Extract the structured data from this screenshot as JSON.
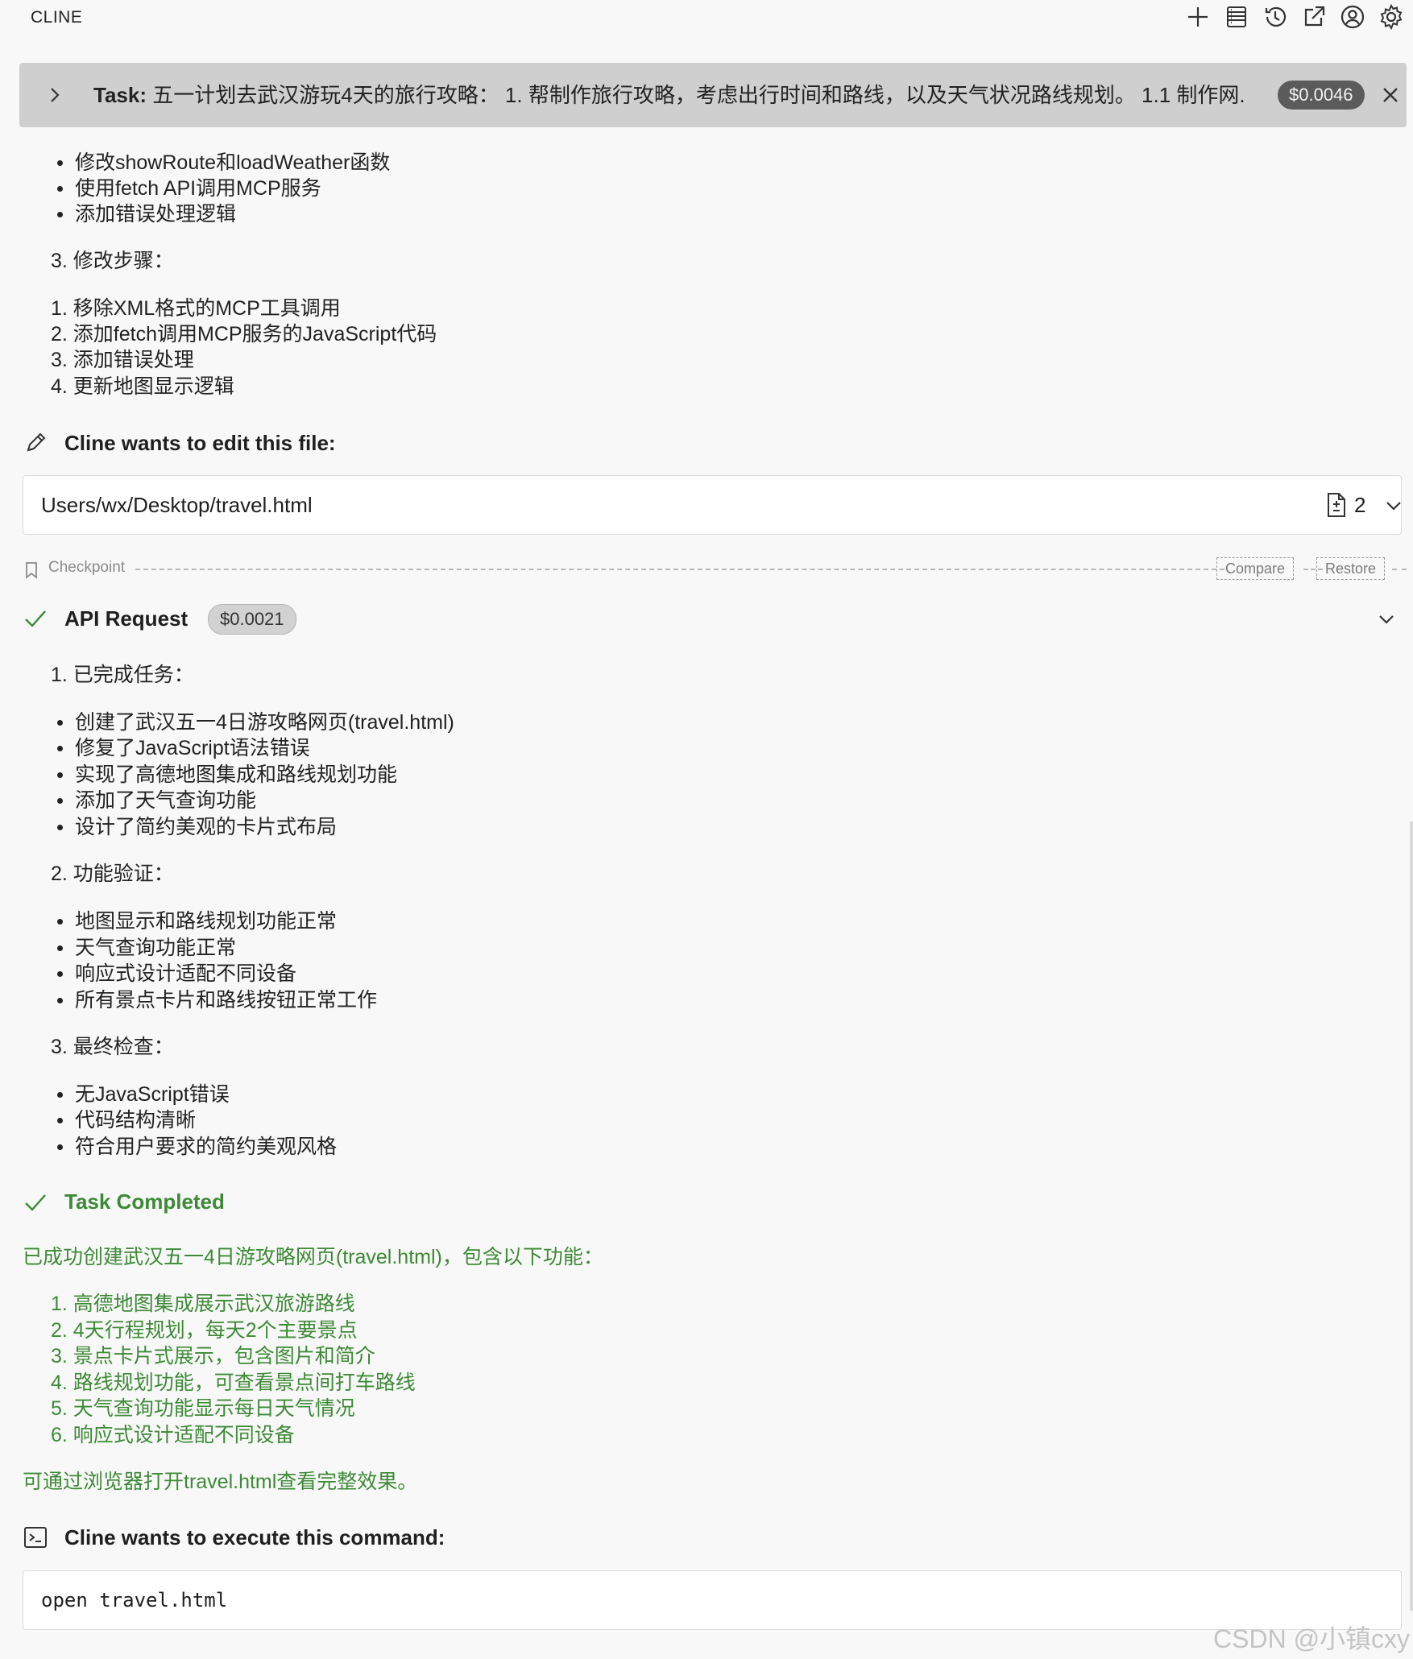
{
  "app": {
    "title": "CLINE"
  },
  "toolbar": {
    "icons": [
      "plus-icon",
      "history-list-icon",
      "clock-history-icon",
      "popout-icon",
      "account-icon",
      "gear-icon"
    ]
  },
  "task": {
    "label": "Task:",
    "text": "五一计划去武汉游玩4天的旅行攻略： 1. 帮制作旅行攻略，考虑出行时间和路线，以及天气状况路线规划。 1.1 制作网...",
    "cost": "$0.0046"
  },
  "intro": {
    "bullets": [
      "修改showRoute和loadWeather函数",
      "使用fetch API调用MCP服务",
      "添加错误处理逻辑"
    ],
    "step3_title": "3. 修改步骤：",
    "steps": [
      "1. 移除XML格式的MCP工具调用",
      "2. 添加fetch调用MCP服务的JavaScript代码",
      "3. 添加错误处理",
      "4. 更新地图显示逻辑"
    ]
  },
  "edit": {
    "heading": "Cline wants to edit this file:",
    "path": "Users/wx/Desktop/travel.html",
    "count": "2"
  },
  "checkpoint": {
    "label": "Checkpoint",
    "compare": "Compare",
    "restore": "Restore"
  },
  "api": {
    "heading": "API Request",
    "cost": "$0.0021",
    "s1_title": "1. 已完成任务：",
    "s1_items": [
      "创建了武汉五一4日游攻略网页(travel.html)",
      "修复了JavaScript语法错误",
      "实现了高德地图集成和路线规划功能",
      "添加了天气查询功能",
      "设计了简约美观的卡片式布局"
    ],
    "s2_title": "2. 功能验证：",
    "s2_items": [
      "地图显示和路线规划功能正常",
      "天气查询功能正常",
      "响应式设计适配不同设备",
      "所有景点卡片和路线按钮正常工作"
    ],
    "s3_title": "3. 最终检查：",
    "s3_items": [
      "无JavaScript错误",
      "代码结构清晰",
      "符合用户要求的简约美观风格"
    ]
  },
  "completed": {
    "heading": "Task Completed",
    "intro": "已成功创建武汉五一4日游攻略网页(travel.html)，包含以下功能：",
    "items": [
      "1. 高德地图集成展示武汉旅游路线",
      "2. 4天行程规划，每天2个主要景点",
      "3. 景点卡片式展示，包含图片和简介",
      "4. 路线规划功能，可查看景点间打车路线",
      "5. 天气查询功能显示每日天气情况",
      "6. 响应式设计适配不同设备"
    ],
    "outro": "可通过浏览器打开travel.html查看完整效果。"
  },
  "command": {
    "heading": "Cline wants to execute this command:",
    "text": "open travel.html"
  },
  "watermark": "CSDN @小镇cxy",
  "colors": {
    "accent_green": "#3d8a36",
    "task_bg": "#cfcfcf",
    "badge_dark": "#5b5b5b"
  }
}
